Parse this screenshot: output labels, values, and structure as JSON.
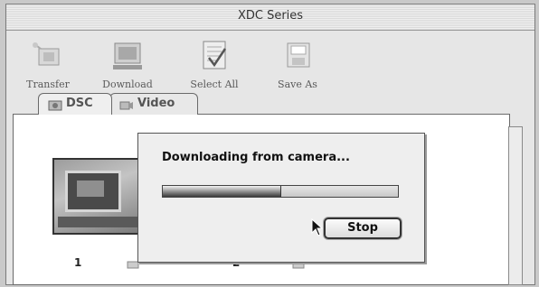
{
  "window": {
    "title": "XDC Series"
  },
  "toolbar": {
    "transfer": {
      "label": "Transfer",
      "icon": "transfer-icon"
    },
    "download": {
      "label": "Download",
      "icon": "download-icon"
    },
    "select_all": {
      "label": "Select All",
      "icon": "select-all-icon"
    },
    "save_as": {
      "label": "Save As",
      "icon": "save-as-icon"
    }
  },
  "tabs": [
    {
      "label": "DSC",
      "icon": "camera-icon",
      "selected": true
    },
    {
      "label": "Video",
      "icon": "video-icon",
      "selected": false
    }
  ],
  "items": [
    {
      "number": "1"
    },
    {
      "number": "2"
    }
  ],
  "dialog": {
    "message": "Downloading from camera...",
    "progress": 0.5,
    "stop_label": "Stop"
  },
  "colors": {
    "window_bg": "#e6e6e6",
    "content_bg": "#ffffff",
    "dialog_bg": "#eeeeee"
  }
}
